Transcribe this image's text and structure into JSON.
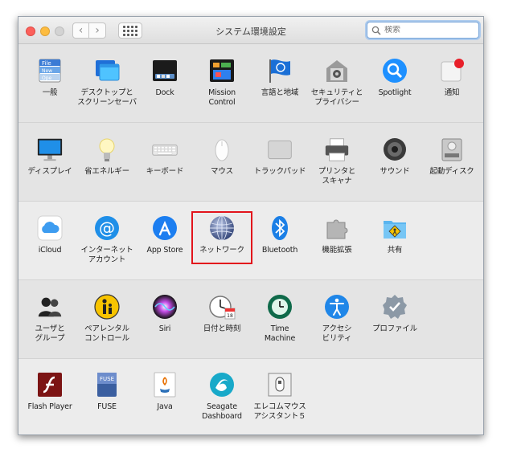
{
  "window": {
    "title": "システム環境設定"
  },
  "search": {
    "placeholder": "検索"
  },
  "rows": [
    [
      {
        "label": "一般",
        "icon": "general-icon"
      },
      {
        "label": "デスクトップと\nスクリーンセーバ",
        "icon": "desktop-screensaver-icon"
      },
      {
        "label": "Dock",
        "icon": "dock-icon"
      },
      {
        "label": "Mission\nControl",
        "icon": "mission-control-icon"
      },
      {
        "label": "言語と地域",
        "icon": "language-region-icon"
      },
      {
        "label": "セキュリティと\nプライバシー",
        "icon": "security-privacy-icon"
      },
      {
        "label": "Spotlight",
        "icon": "spotlight-icon"
      },
      {
        "label": "通知",
        "icon": "notifications-icon"
      }
    ],
    [
      {
        "label": "ディスプレイ",
        "icon": "displays-icon"
      },
      {
        "label": "省エネルギー",
        "icon": "energy-saver-icon"
      },
      {
        "label": "キーボード",
        "icon": "keyboard-icon"
      },
      {
        "label": "マウス",
        "icon": "mouse-icon"
      },
      {
        "label": "トラックパッド",
        "icon": "trackpad-icon"
      },
      {
        "label": "プリンタと\nスキャナ",
        "icon": "printers-scanners-icon"
      },
      {
        "label": "サウンド",
        "icon": "sound-icon"
      },
      {
        "label": "起動ディスク",
        "icon": "startup-disk-icon"
      }
    ],
    [
      {
        "label": "iCloud",
        "icon": "icloud-icon"
      },
      {
        "label": "インターネット\nアカウント",
        "icon": "internet-accounts-icon"
      },
      {
        "label": "App Store",
        "icon": "app-store-icon"
      },
      {
        "label": "ネットワーク",
        "icon": "network-icon"
      },
      {
        "label": "Bluetooth",
        "icon": "bluetooth-icon"
      },
      {
        "label": "機能拡張",
        "icon": "extensions-icon"
      },
      {
        "label": "共有",
        "icon": "sharing-icon"
      }
    ],
    [
      {
        "label": "ユーザと\nグループ",
        "icon": "users-groups-icon"
      },
      {
        "label": "ペアレンタル\nコントロール",
        "icon": "parental-controls-icon"
      },
      {
        "label": "Siri",
        "icon": "siri-icon"
      },
      {
        "label": "日付と時刻",
        "icon": "date-time-icon"
      },
      {
        "label": "Time\nMachine",
        "icon": "time-machine-icon"
      },
      {
        "label": "アクセシ\nビリティ",
        "icon": "accessibility-icon"
      },
      {
        "label": "プロファイル",
        "icon": "profiles-icon"
      }
    ],
    [
      {
        "label": "Flash Player",
        "icon": "flash-player-icon"
      },
      {
        "label": "FUSE",
        "icon": "fuse-icon"
      },
      {
        "label": "Java",
        "icon": "java-icon"
      },
      {
        "label": "Seagate\nDashboard",
        "icon": "seagate-dashboard-icon"
      },
      {
        "label": "エレコムマウス\nアシスタント５",
        "icon": "elecom-mouse-icon"
      }
    ]
  ],
  "icon_text": {
    "general": [
      "File",
      "New",
      "Ope"
    ],
    "fuse": "FUSE",
    "calendar_day": "18"
  },
  "colors": {
    "highlight": "#e2141c",
    "search_focus": "#79a6d9"
  }
}
